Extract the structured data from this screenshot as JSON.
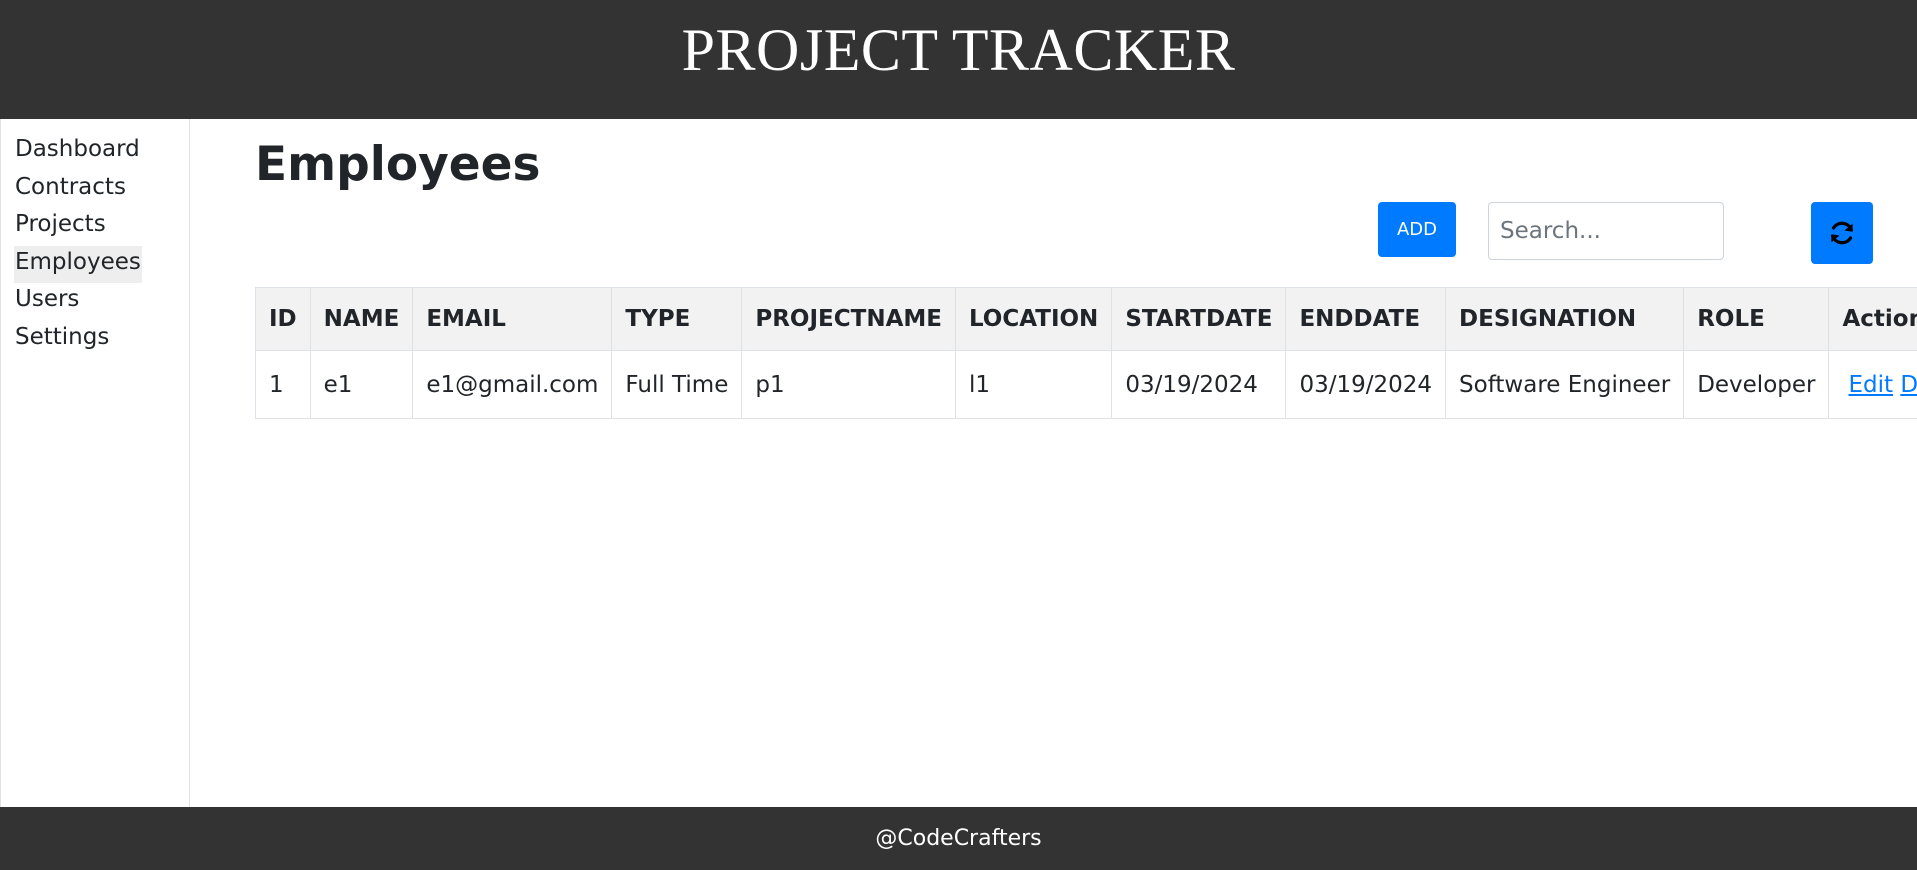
{
  "header": {
    "title": "PROJECT TRACKER"
  },
  "sidebar": {
    "items": [
      {
        "label": "Dashboard",
        "active": false
      },
      {
        "label": "Contracts",
        "active": false
      },
      {
        "label": "Projects",
        "active": false
      },
      {
        "label": "Employees",
        "active": true
      },
      {
        "label": "Users",
        "active": false
      },
      {
        "label": "Settings",
        "active": false
      }
    ]
  },
  "main": {
    "title": "Employees",
    "add_label": "ADD",
    "search": {
      "placeholder": "Search...",
      "value": ""
    },
    "refresh_icon": "refresh-icon",
    "table": {
      "columns": [
        "ID",
        "NAME",
        "EMAIL",
        "TYPE",
        "PROJECTNAME",
        "LOCATION",
        "STARTDATE",
        "ENDDATE",
        "DESIGNATION",
        "ROLE",
        "Actions"
      ],
      "rows": [
        {
          "id": "1",
          "name": "e1",
          "email": "e1@gmail.com",
          "type": "Full Time",
          "projectname": "p1",
          "location": "l1",
          "startdate": "03/19/2024",
          "enddate": "03/19/2024",
          "designation": "Software Engineer",
          "role": "Developer",
          "edit_label": "Edit",
          "delete_label": "Delete"
        }
      ]
    }
  },
  "footer": {
    "text": "@CodeCrafters"
  },
  "colors": {
    "header_bg": "#333333",
    "accent": "#007bff",
    "table_header_bg": "#f2f2f2"
  }
}
